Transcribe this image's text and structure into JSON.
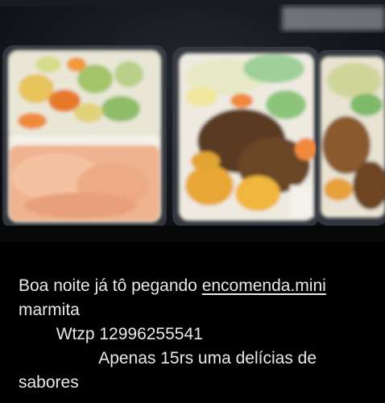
{
  "post": {
    "photo_alt": "",
    "caption": {
      "part1": "Boa noite já tô pegando ",
      "link_text": "encomenda.mini",
      "part2": "\nmarmita\n        Wtzp 12996255541\n                 Apenas 15rs uma delícias de\nsabores"
    }
  },
  "colors": {
    "background": "#000000",
    "text": "#e8e8e8",
    "photo_background": "#0d0e12"
  }
}
